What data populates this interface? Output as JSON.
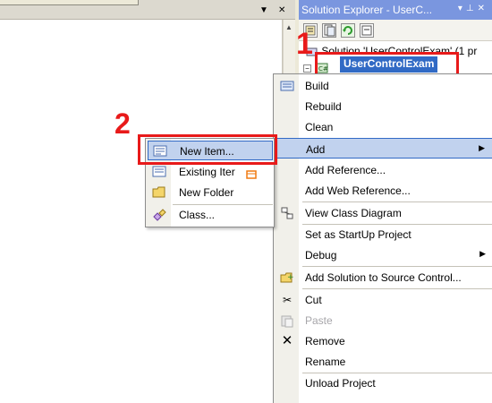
{
  "solution_explorer": {
    "title": "Solution Explorer - UserC...",
    "solution_node": "Solution 'UserControlExam' (1 pr",
    "project_node": "UserControlExam"
  },
  "annotations": {
    "step1": "1",
    "step2": "2"
  },
  "context_menu": {
    "items": [
      {
        "label": "Build",
        "icon": "build-icon"
      },
      {
        "label": "Rebuild",
        "icon": ""
      },
      {
        "label": "Clean",
        "icon": ""
      },
      {
        "label": "Add",
        "icon": "",
        "submenu": true
      },
      {
        "label": "Add Reference...",
        "icon": ""
      },
      {
        "label": "Add Web Reference...",
        "icon": ""
      },
      {
        "label": "View Class Diagram",
        "icon": "class-diagram-icon"
      },
      {
        "label": "Set as StartUp Project",
        "icon": ""
      },
      {
        "label": "Debug",
        "icon": "",
        "submenu": true
      },
      {
        "label": "Add Solution to Source Control...",
        "icon": "source-control-icon"
      },
      {
        "label": "Cut",
        "icon": "scissors-icon"
      },
      {
        "label": "Paste",
        "icon": "paste-icon",
        "disabled": true
      },
      {
        "label": "Remove",
        "icon": "remove-x-icon"
      },
      {
        "label": "Rename",
        "icon": ""
      },
      {
        "label": "Unload Project",
        "icon": ""
      }
    ]
  },
  "add_submenu": {
    "items": [
      {
        "label": "New Item...",
        "icon": "new-item-icon"
      },
      {
        "label": "Existing Iter",
        "icon": "existing-item-icon"
      },
      {
        "label": "New Folder",
        "icon": "folder-icon"
      },
      {
        "label": "Class...",
        "icon": "class-icon"
      }
    ]
  },
  "colors": {
    "highlight": "#c1d2ee",
    "highlight_border": "#316ac5",
    "annotation_red": "#e81a1a",
    "title_bar": "#7a96df"
  }
}
